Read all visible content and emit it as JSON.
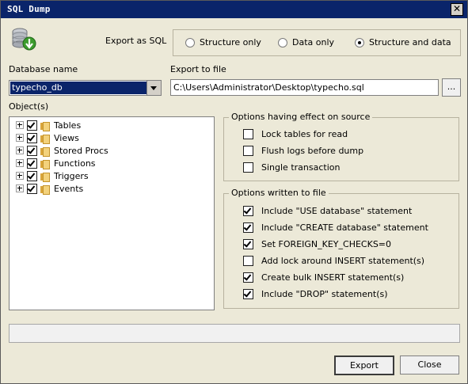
{
  "window": {
    "title": "SQL Dump",
    "close_symbol": "✕"
  },
  "export_as": {
    "label": "Export as SQL",
    "options": [
      {
        "label": "Structure only",
        "selected": false
      },
      {
        "label": "Data only",
        "selected": false
      },
      {
        "label": "Structure and data",
        "selected": true
      }
    ]
  },
  "database": {
    "label": "Database name",
    "value": "typecho_db"
  },
  "export_file": {
    "label": "Export to file",
    "value": "C:\\Users\\Administrator\\Desktop\\typecho.sql",
    "browse_label": "..."
  },
  "objects": {
    "label": "Object(s)",
    "items": [
      {
        "label": "Tables",
        "checked": true
      },
      {
        "label": "Views",
        "checked": true
      },
      {
        "label": "Stored Procs",
        "checked": true
      },
      {
        "label": "Functions",
        "checked": true
      },
      {
        "label": "Triggers",
        "checked": true
      },
      {
        "label": "Events",
        "checked": true
      }
    ]
  },
  "source_options": {
    "title": "Options having effect on source",
    "items": [
      {
        "label": "Lock tables for read",
        "checked": false
      },
      {
        "label": "Flush logs before dump",
        "checked": false
      },
      {
        "label": "Single transaction",
        "checked": false
      }
    ]
  },
  "file_options": {
    "title": "Options written to file",
    "items": [
      {
        "label": "Include \"USE database\" statement",
        "checked": true
      },
      {
        "label": "Include \"CREATE database\" statement",
        "checked": true
      },
      {
        "label": "Set FOREIGN_KEY_CHECKS=0",
        "checked": true
      },
      {
        "label": "Add lock around INSERT statement(s)",
        "checked": false
      },
      {
        "label": "Create bulk INSERT statement(s)",
        "checked": true
      },
      {
        "label": "Include \"DROP\" statement(s)",
        "checked": true
      }
    ]
  },
  "progress": {
    "fraction": 0
  },
  "buttons": {
    "export": "Export",
    "close": "Close"
  },
  "colors": {
    "titlebar": "#0a246a",
    "dialog_bg": "#ece9d8",
    "selection": "#0a246a"
  }
}
